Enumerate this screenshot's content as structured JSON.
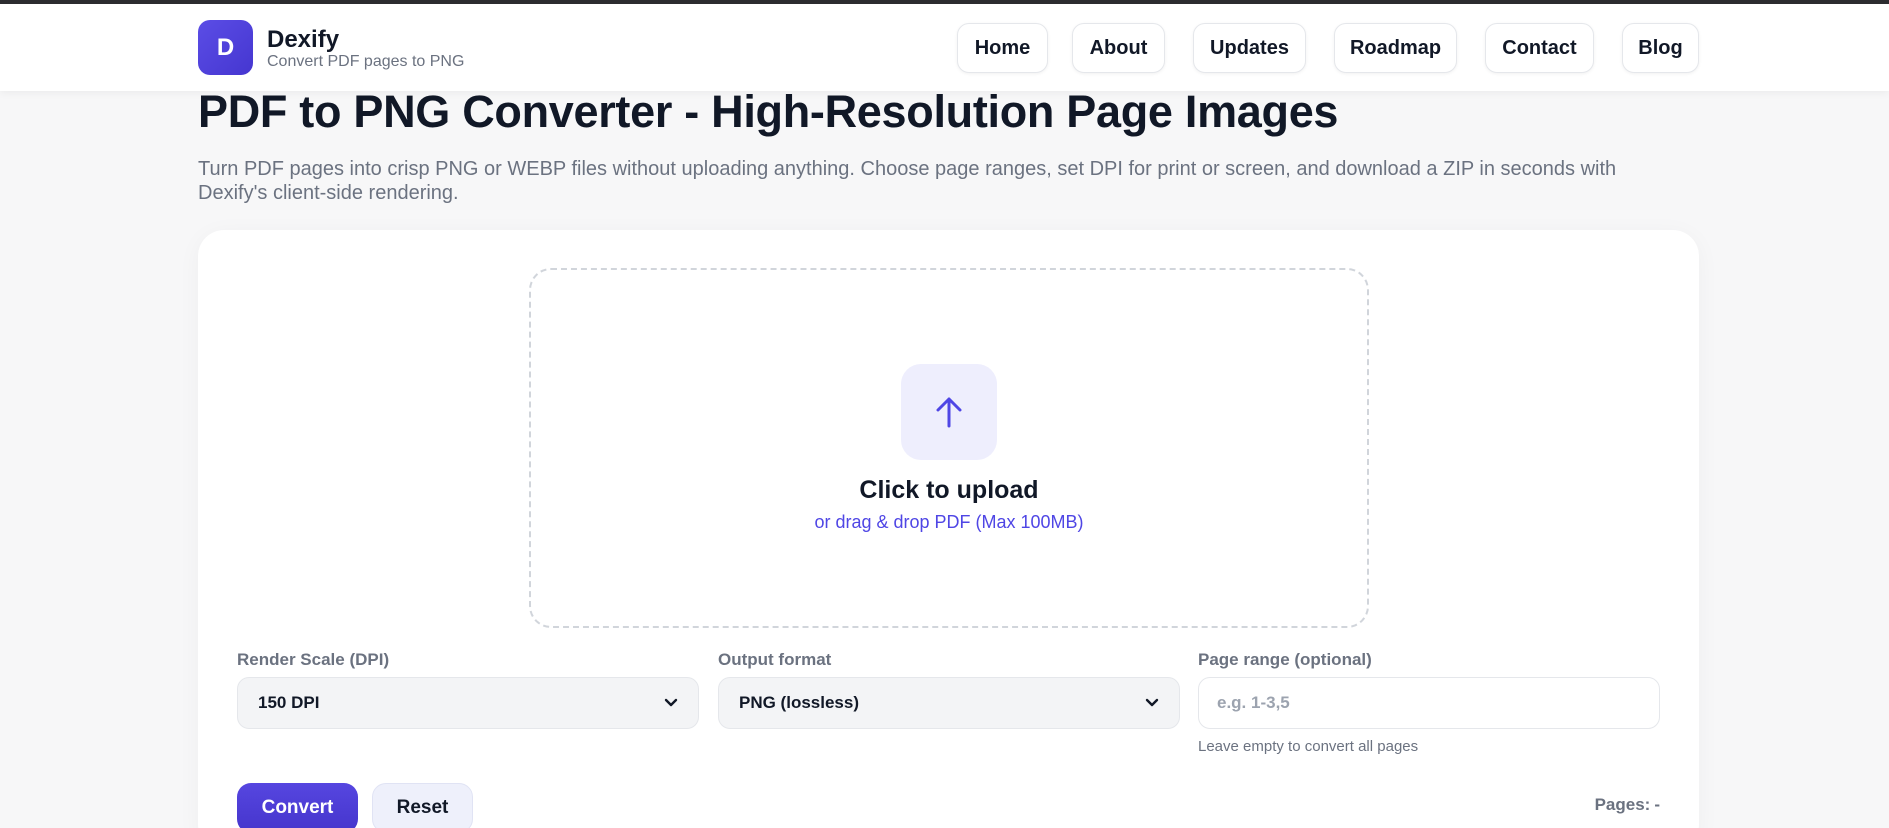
{
  "header": {
    "logo_letter": "D",
    "brand_name": "Dexify",
    "brand_tagline": "Convert PDF pages to PNG",
    "nav": [
      {
        "label": "Home"
      },
      {
        "label": "About"
      },
      {
        "label": "Updates"
      },
      {
        "label": "Roadmap"
      },
      {
        "label": "Contact"
      },
      {
        "label": "Blog"
      }
    ]
  },
  "main": {
    "title": "PDF to PNG Converter - High-Resolution Page Images",
    "description": "Turn PDF pages into crisp PNG or WEBP files without uploading anything. Choose page ranges, set DPI for print or screen, and download a ZIP in seconds with Dexify's client-side rendering."
  },
  "upload": {
    "icon": "arrow-up-icon",
    "title": "Click to upload",
    "subtitle": "or drag & drop PDF (Max 100MB)"
  },
  "options": {
    "dpi": {
      "label": "Render Scale (DPI)",
      "value": "150 DPI"
    },
    "format": {
      "label": "Output format",
      "value": "PNG (lossless)"
    },
    "range": {
      "label": "Page range (optional)",
      "placeholder": "e.g. 1-3,5",
      "hint": "Leave empty to convert all pages"
    }
  },
  "actions": {
    "convert_label": "Convert",
    "reset_label": "Reset",
    "pages_label": "Pages:",
    "pages_value": "-"
  },
  "colors": {
    "accent": "#4f46e5",
    "upload_icon_bg": "#eeeefd"
  }
}
